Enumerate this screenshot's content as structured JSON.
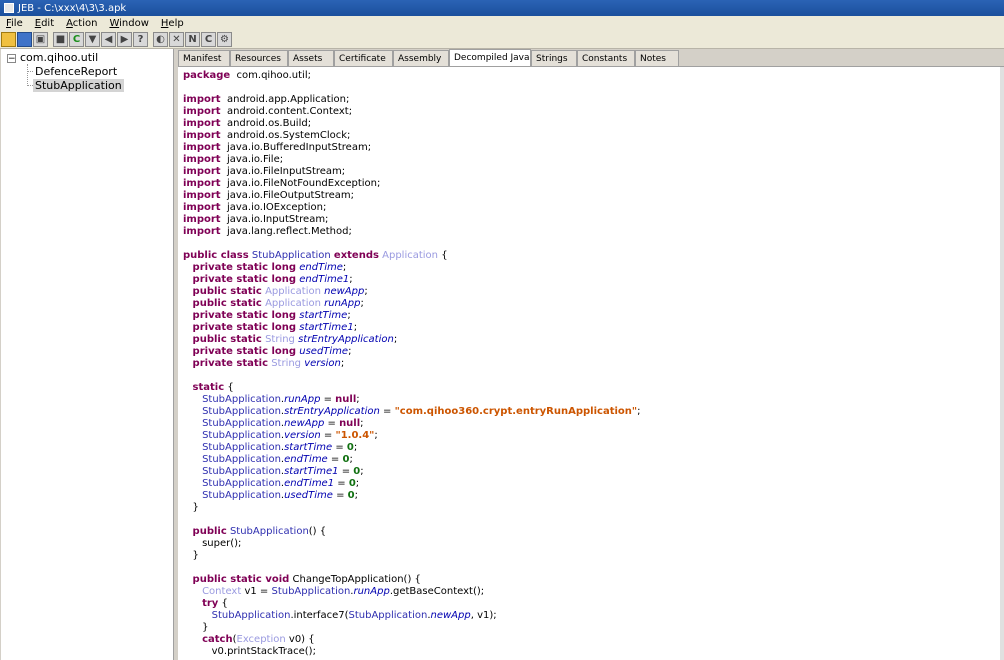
{
  "window": {
    "title": "JEB - C:\\xxx\\4\\3\\3.apk"
  },
  "menu": [
    {
      "label": "File",
      "key": "F",
      "rest": "ile"
    },
    {
      "label": "Edit",
      "key": "E",
      "rest": "dit"
    },
    {
      "label": "Action",
      "key": "A",
      "rest": "ction"
    },
    {
      "label": "Window",
      "key": "W",
      "rest": "indow"
    },
    {
      "label": "Help",
      "key": "H",
      "rest": "elp"
    }
  ],
  "toolbar": {
    "buttons": [
      "open-folder-icon",
      "save-icon",
      "floppy-icon",
      "stop-icon",
      "refresh-icon",
      "filter-icon",
      "back-icon",
      "forward-icon",
      "help-icon",
      "code-icon",
      "cross-icon",
      "n-icon",
      "c-icon",
      "gear-icon"
    ],
    "glyphs": [
      "",
      "",
      "▣",
      "■",
      "C",
      "▼",
      "◀",
      "▶",
      "?",
      "◐",
      "✕",
      "N",
      "C",
      "⚙"
    ]
  },
  "tree": {
    "package": "com.qihoo.util",
    "toggle": "−",
    "children": [
      "DefenceReport",
      "StubApplication"
    ]
  },
  "tabs": [
    "Manifest",
    "Resources",
    "Assets",
    "Certificate",
    "Assembly",
    "Decompiled Java",
    "Strings",
    "Constants",
    "Notes"
  ],
  "active_tab_close": "☒",
  "code_lines": [
    [
      [
        "kw",
        "package"
      ],
      [
        "",
        "  com.qihoo.util;"
      ]
    ],
    [],
    [
      [
        "kw",
        "import"
      ],
      [
        "",
        "  android.app.Application;"
      ]
    ],
    [
      [
        "kw",
        "import"
      ],
      [
        "",
        "  android.content.Context;"
      ]
    ],
    [
      [
        "kw",
        "import"
      ],
      [
        "",
        "  android.os.Build;"
      ]
    ],
    [
      [
        "kw",
        "import"
      ],
      [
        "",
        "  android.os.SystemClock;"
      ]
    ],
    [
      [
        "kw",
        "import"
      ],
      [
        "",
        "  java.io.BufferedInputStream;"
      ]
    ],
    [
      [
        "kw",
        "import"
      ],
      [
        "",
        "  java.io.File;"
      ]
    ],
    [
      [
        "kw",
        "import"
      ],
      [
        "",
        "  java.io.FileInputStream;"
      ]
    ],
    [
      [
        "kw",
        "import"
      ],
      [
        "",
        "  java.io.FileNotFoundException;"
      ]
    ],
    [
      [
        "kw",
        "import"
      ],
      [
        "",
        "  java.io.FileOutputStream;"
      ]
    ],
    [
      [
        "kw",
        "import"
      ],
      [
        "",
        "  java.io.IOException;"
      ]
    ],
    [
      [
        "kw",
        "import"
      ],
      [
        "",
        "  java.io.InputStream;"
      ]
    ],
    [
      [
        "kw",
        "import"
      ],
      [
        "",
        "  java.lang.reflect.Method;"
      ]
    ],
    [],
    [
      [
        "kw",
        "public class"
      ],
      [
        "",
        " "
      ],
      [
        "cl",
        "StubApplication"
      ],
      [
        "",
        " "
      ],
      [
        "kw",
        "extends"
      ],
      [
        "",
        " "
      ],
      [
        "ty",
        "Application"
      ],
      [
        "",
        " {"
      ]
    ],
    [
      [
        "",
        "   "
      ],
      [
        "kw",
        "private static long"
      ],
      [
        "",
        " "
      ],
      [
        "fi",
        "endTime"
      ],
      [
        "",
        ";"
      ]
    ],
    [
      [
        "",
        "   "
      ],
      [
        "kw",
        "private static long"
      ],
      [
        "",
        " "
      ],
      [
        "fi",
        "endTime1"
      ],
      [
        "",
        ";"
      ]
    ],
    [
      [
        "",
        "   "
      ],
      [
        "kw",
        "public static"
      ],
      [
        "",
        " "
      ],
      [
        "ty",
        "Application"
      ],
      [
        "",
        " "
      ],
      [
        "fi",
        "newApp"
      ],
      [
        "",
        ";"
      ]
    ],
    [
      [
        "",
        "   "
      ],
      [
        "kw",
        "public static"
      ],
      [
        "",
        " "
      ],
      [
        "ty",
        "Application"
      ],
      [
        "",
        " "
      ],
      [
        "fi",
        "runApp"
      ],
      [
        "",
        ";"
      ]
    ],
    [
      [
        "",
        "   "
      ],
      [
        "kw",
        "private static long"
      ],
      [
        "",
        " "
      ],
      [
        "fi",
        "startTime"
      ],
      [
        "",
        ";"
      ]
    ],
    [
      [
        "",
        "   "
      ],
      [
        "kw",
        "private static long"
      ],
      [
        "",
        " "
      ],
      [
        "fi",
        "startTime1"
      ],
      [
        "",
        ";"
      ]
    ],
    [
      [
        "",
        "   "
      ],
      [
        "kw",
        "public static"
      ],
      [
        "",
        " "
      ],
      [
        "ty",
        "String"
      ],
      [
        "",
        " "
      ],
      [
        "fi",
        "strEntryApplication"
      ],
      [
        "",
        ";"
      ]
    ],
    [
      [
        "",
        "   "
      ],
      [
        "kw",
        "private static long"
      ],
      [
        "",
        " "
      ],
      [
        "fi",
        "usedTime"
      ],
      [
        "",
        ";"
      ]
    ],
    [
      [
        "",
        "   "
      ],
      [
        "kw",
        "private static"
      ],
      [
        "",
        " "
      ],
      [
        "ty",
        "String"
      ],
      [
        "",
        " "
      ],
      [
        "fi",
        "version"
      ],
      [
        "",
        ";"
      ]
    ],
    [],
    [
      [
        "",
        "   "
      ],
      [
        "kw",
        "static"
      ],
      [
        "",
        " {"
      ]
    ],
    [
      [
        "",
        "      "
      ],
      [
        "cl",
        "StubApplication"
      ],
      [
        "",
        "."
      ],
      [
        "fi",
        "runApp"
      ],
      [
        "",
        " = "
      ],
      [
        "kw",
        "null"
      ],
      [
        "",
        ";"
      ]
    ],
    [
      [
        "",
        "      "
      ],
      [
        "cl",
        "StubApplication"
      ],
      [
        "",
        "."
      ],
      [
        "fi",
        "strEntryApplication"
      ],
      [
        "",
        " = "
      ],
      [
        "st",
        "\"com.qihoo360.crypt.entryRunApplication\""
      ],
      [
        "",
        ";"
      ]
    ],
    [
      [
        "",
        "      "
      ],
      [
        "cl",
        "StubApplication"
      ],
      [
        "",
        "."
      ],
      [
        "fi",
        "newApp"
      ],
      [
        "",
        " = "
      ],
      [
        "kw",
        "null"
      ],
      [
        "",
        ";"
      ]
    ],
    [
      [
        "",
        "      "
      ],
      [
        "cl",
        "StubApplication"
      ],
      [
        "",
        "."
      ],
      [
        "fi",
        "version"
      ],
      [
        "",
        " = "
      ],
      [
        "st",
        "\"1.0.4\""
      ],
      [
        "",
        ";"
      ]
    ],
    [
      [
        "",
        "      "
      ],
      [
        "cl",
        "StubApplication"
      ],
      [
        "",
        "."
      ],
      [
        "fi",
        "startTime"
      ],
      [
        "",
        " = "
      ],
      [
        "nu",
        "0"
      ],
      [
        "",
        ";"
      ]
    ],
    [
      [
        "",
        "      "
      ],
      [
        "cl",
        "StubApplication"
      ],
      [
        "",
        "."
      ],
      [
        "fi",
        "endTime"
      ],
      [
        "",
        " = "
      ],
      [
        "nu",
        "0"
      ],
      [
        "",
        ";"
      ]
    ],
    [
      [
        "",
        "      "
      ],
      [
        "cl",
        "StubApplication"
      ],
      [
        "",
        "."
      ],
      [
        "fi",
        "startTime1"
      ],
      [
        "",
        " = "
      ],
      [
        "nu",
        "0"
      ],
      [
        "",
        ";"
      ]
    ],
    [
      [
        "",
        "      "
      ],
      [
        "cl",
        "StubApplication"
      ],
      [
        "",
        "."
      ],
      [
        "fi",
        "endTime1"
      ],
      [
        "",
        " = "
      ],
      [
        "nu",
        "0"
      ],
      [
        "",
        ";"
      ]
    ],
    [
      [
        "",
        "      "
      ],
      [
        "cl",
        "StubApplication"
      ],
      [
        "",
        "."
      ],
      [
        "fi",
        "usedTime"
      ],
      [
        "",
        " = "
      ],
      [
        "nu",
        "0"
      ],
      [
        "",
        ";"
      ]
    ],
    [
      [
        "",
        "   }"
      ]
    ],
    [],
    [
      [
        "",
        "   "
      ],
      [
        "kw",
        "public"
      ],
      [
        "",
        " "
      ],
      [
        "cl",
        "StubApplication"
      ],
      [
        "",
        "() {"
      ]
    ],
    [
      [
        "",
        "      super();"
      ]
    ],
    [
      [
        "",
        "   }"
      ]
    ],
    [],
    [
      [
        "",
        "   "
      ],
      [
        "kw",
        "public static void"
      ],
      [
        "",
        " ChangeTopApplication() {"
      ]
    ],
    [
      [
        "",
        "      "
      ],
      [
        "ty",
        "Context"
      ],
      [
        "",
        " v1 = "
      ],
      [
        "cl",
        "StubApplication"
      ],
      [
        "",
        "."
      ],
      [
        "fi",
        "runApp"
      ],
      [
        "",
        ".getBaseContext();"
      ]
    ],
    [
      [
        "",
        "      "
      ],
      [
        "kw",
        "try"
      ],
      [
        "",
        " {"
      ]
    ],
    [
      [
        "",
        "         "
      ],
      [
        "cl",
        "StubApplication"
      ],
      [
        "",
        ".interface7("
      ],
      [
        "cl",
        "StubApplication"
      ],
      [
        "",
        "."
      ],
      [
        "fi",
        "newApp"
      ],
      [
        "",
        ", v1);"
      ]
    ],
    [
      [
        "",
        "      }"
      ]
    ],
    [
      [
        "",
        "      "
      ],
      [
        "kw",
        "catch"
      ],
      [
        "",
        "("
      ],
      [
        "ty",
        "Exception"
      ],
      [
        "",
        " v0) {"
      ]
    ],
    [
      [
        "",
        "         v0.printStackTrace();"
      ]
    ]
  ]
}
